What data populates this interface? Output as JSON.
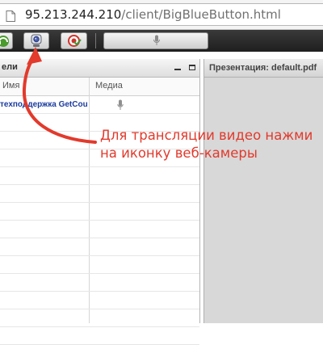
{
  "browser": {
    "url_host": "95.213.244.210",
    "url_path": "/client/BigBlueButton.html"
  },
  "toolbar": {
    "buttons": [
      {
        "icon": "headset-icon",
        "state": "active"
      },
      {
        "icon": "webcam-icon",
        "state": "normal"
      },
      {
        "icon": "desktop-share-icon",
        "state": "normal"
      }
    ],
    "mic_icon": "microphone-icon"
  },
  "users_panel": {
    "title": "ели",
    "columns": {
      "name": "Имя",
      "media": "Медиа"
    },
    "rows": [
      {
        "name": "техподдержка GetCou",
        "has_mic": true
      },
      {
        "name": "",
        "has_mic": false
      },
      {
        "name": "",
        "has_mic": false
      },
      {
        "name": "",
        "has_mic": false
      },
      {
        "name": "",
        "has_mic": false
      },
      {
        "name": "",
        "has_mic": false
      },
      {
        "name": "",
        "has_mic": false
      },
      {
        "name": "",
        "has_mic": false
      },
      {
        "name": "",
        "has_mic": false
      },
      {
        "name": "",
        "has_mic": false
      },
      {
        "name": "",
        "has_mic": false
      },
      {
        "name": "",
        "has_mic": false
      },
      {
        "name": "",
        "has_mic": false
      },
      {
        "name": "",
        "has_mic": false
      }
    ]
  },
  "presentation_panel": {
    "title": "Презентация: default.pdf"
  },
  "annotation": {
    "line1": "Для трансляции видео нажми",
    "line2": "на иконку веб-камеры",
    "color": "#e23a2c"
  }
}
